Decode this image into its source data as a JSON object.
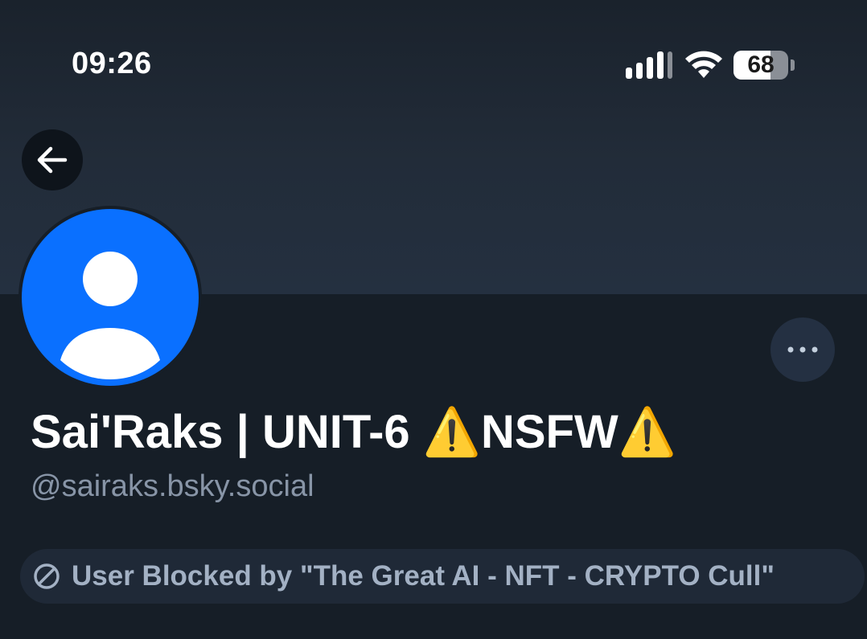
{
  "status_bar": {
    "time": "09:26",
    "battery_level": "68",
    "battery_fraction": 0.68,
    "signal_icon": "cellular-signal-icon",
    "wifi_icon": "wifi-icon",
    "battery_icon": "battery-icon"
  },
  "profile": {
    "back_icon": "arrow-left-icon",
    "avatar_icon": "default-user-avatar-icon",
    "more_icon": "ellipsis-icon",
    "display_name": "Sai'Raks | UNIT-6 ⚠️NSFW⚠️",
    "handle": "@sairaks.bsky.social",
    "blocked_icon": "block-circle-icon",
    "blocked_label": "User Blocked by \"The Great AI - NFT - CRYPTO Cull\""
  },
  "colors": {
    "background": "#161e27",
    "avatar_blue": "#0a70ff",
    "muted_text": "#8895a7",
    "pill_background": "#1f2937",
    "pill_text": "#a3b1c4"
  }
}
